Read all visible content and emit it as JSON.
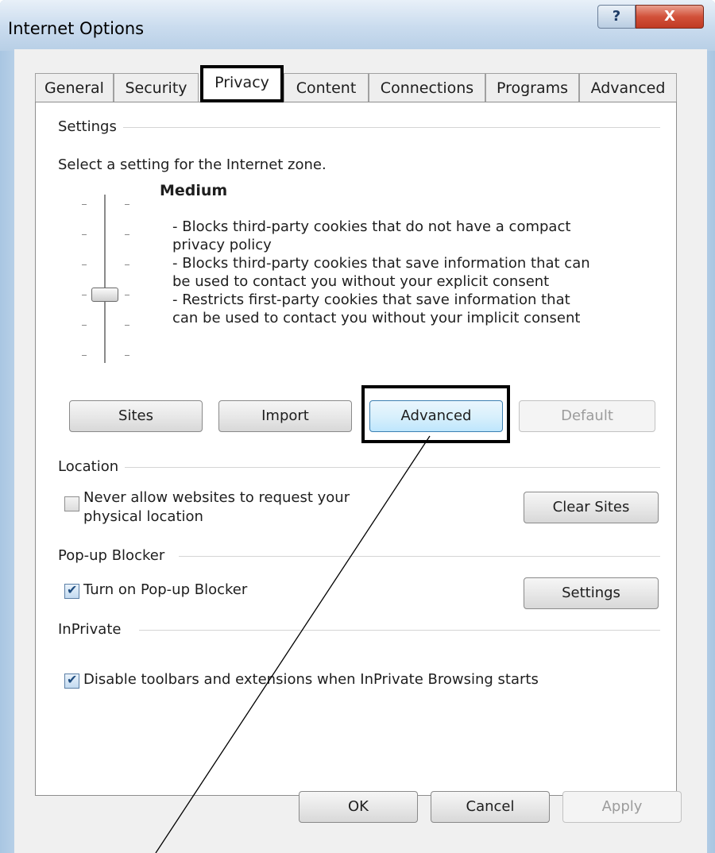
{
  "window": {
    "title": "Internet Options",
    "help_glyph": "?",
    "close_glyph": "X"
  },
  "tabs": [
    "General",
    "Security",
    "Privacy",
    "Content",
    "Connections",
    "Programs",
    "Advanced"
  ],
  "active_tab": "Privacy",
  "settings": {
    "group_label": "Settings",
    "prompt": "Select a setting for the Internet zone.",
    "level": "Medium",
    "description": "- Blocks third-party cookies that do not have a compact\nprivacy policy\n- Blocks third-party cookies that save information that can\nbe used to contact you without your explicit consent\n- Restricts first-party cookies that save information that\ncan be used to contact you without your implicit consent",
    "buttons": {
      "sites": "Sites",
      "import": "Import",
      "advanced": "Advanced",
      "default": "Default"
    }
  },
  "location": {
    "group_label": "Location",
    "checkbox_label": "Never allow websites to request your\nphysical location",
    "checked": false,
    "clear_sites": "Clear Sites"
  },
  "popup": {
    "group_label": "Pop-up Blocker",
    "checkbox_label": "Turn on Pop-up Blocker",
    "checked": true,
    "settings_button": "Settings"
  },
  "inprivate": {
    "group_label": "InPrivate",
    "checkbox_label": "Disable toolbars and extensions when InPrivate Browsing starts",
    "checked": true
  },
  "footer": {
    "ok": "OK",
    "cancel": "Cancel",
    "apply": "Apply"
  }
}
